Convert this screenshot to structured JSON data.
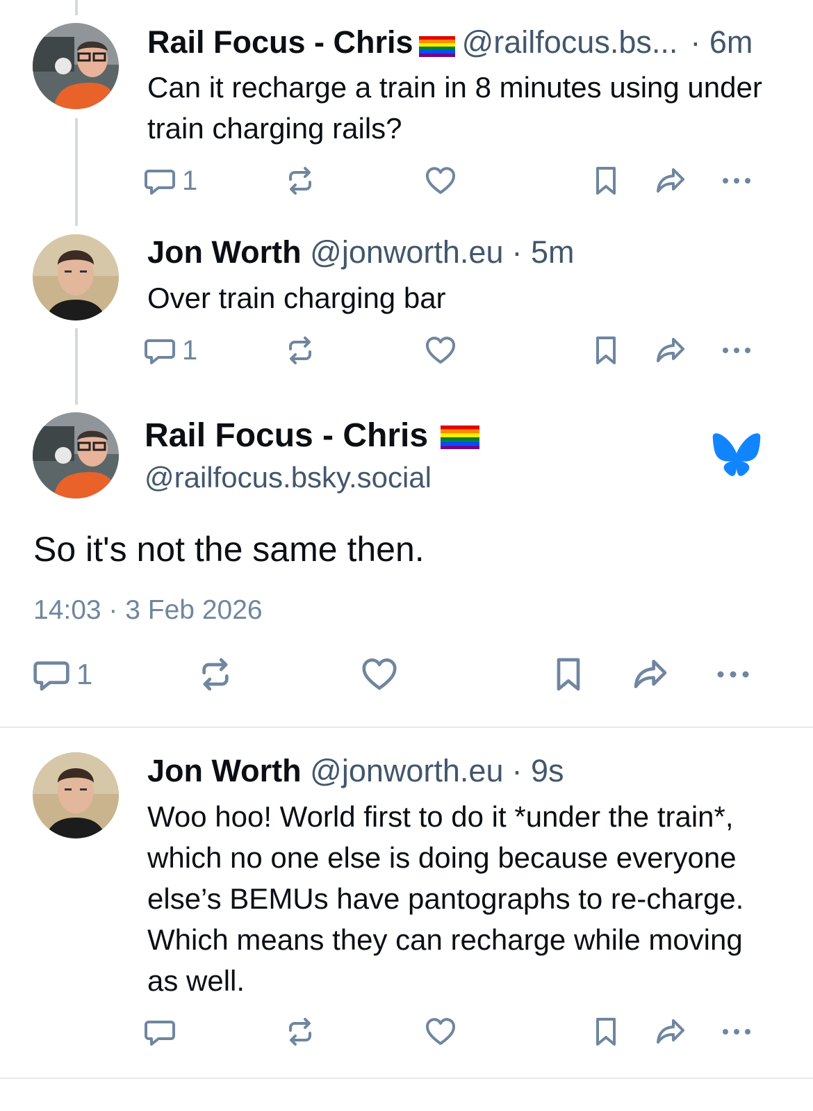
{
  "posts": [
    {
      "author": "Rail Focus - Chris",
      "handle": "@railfocus.bs...",
      "age": "· 6m",
      "text": "Can it recharge a train in 8 minutes using under train charging rails?",
      "reply_count": "1"
    },
    {
      "author": "Jon Worth",
      "handle": "@jonworth.eu",
      "age": "· 5m",
      "text": "Over train charging bar",
      "reply_count": "1"
    }
  ],
  "focus": {
    "author": "Rail Focus - Chris",
    "handle": "@railfocus.bsky.social",
    "text": "So it's not the same then.",
    "timestamp": "14:03 · 3 Feb 2026",
    "reply_count": "1",
    "brand_icon": "bluesky-butterfly-icon",
    "brand_color": "#1185fe"
  },
  "reply": {
    "author": "Jon Worth",
    "handle": "@jonworth.eu",
    "age": "· 9s",
    "text": "Woo hoo! World first to do it *under the train*, which no one else is doing because everyone else’s BEMUs have pantographs to re-charge. Which means they can recharge while moving as well."
  },
  "icons": [
    "reply-icon",
    "repost-icon",
    "like-icon",
    "bookmark-icon",
    "share-icon",
    "more-icon",
    "rainbow-flag-icon"
  ],
  "colors": {
    "text": "#0b0f14",
    "meta": "#42576c",
    "icon": "#6f869f",
    "thread_line": "#d4d9e1",
    "divider": "#e4e8ee"
  }
}
